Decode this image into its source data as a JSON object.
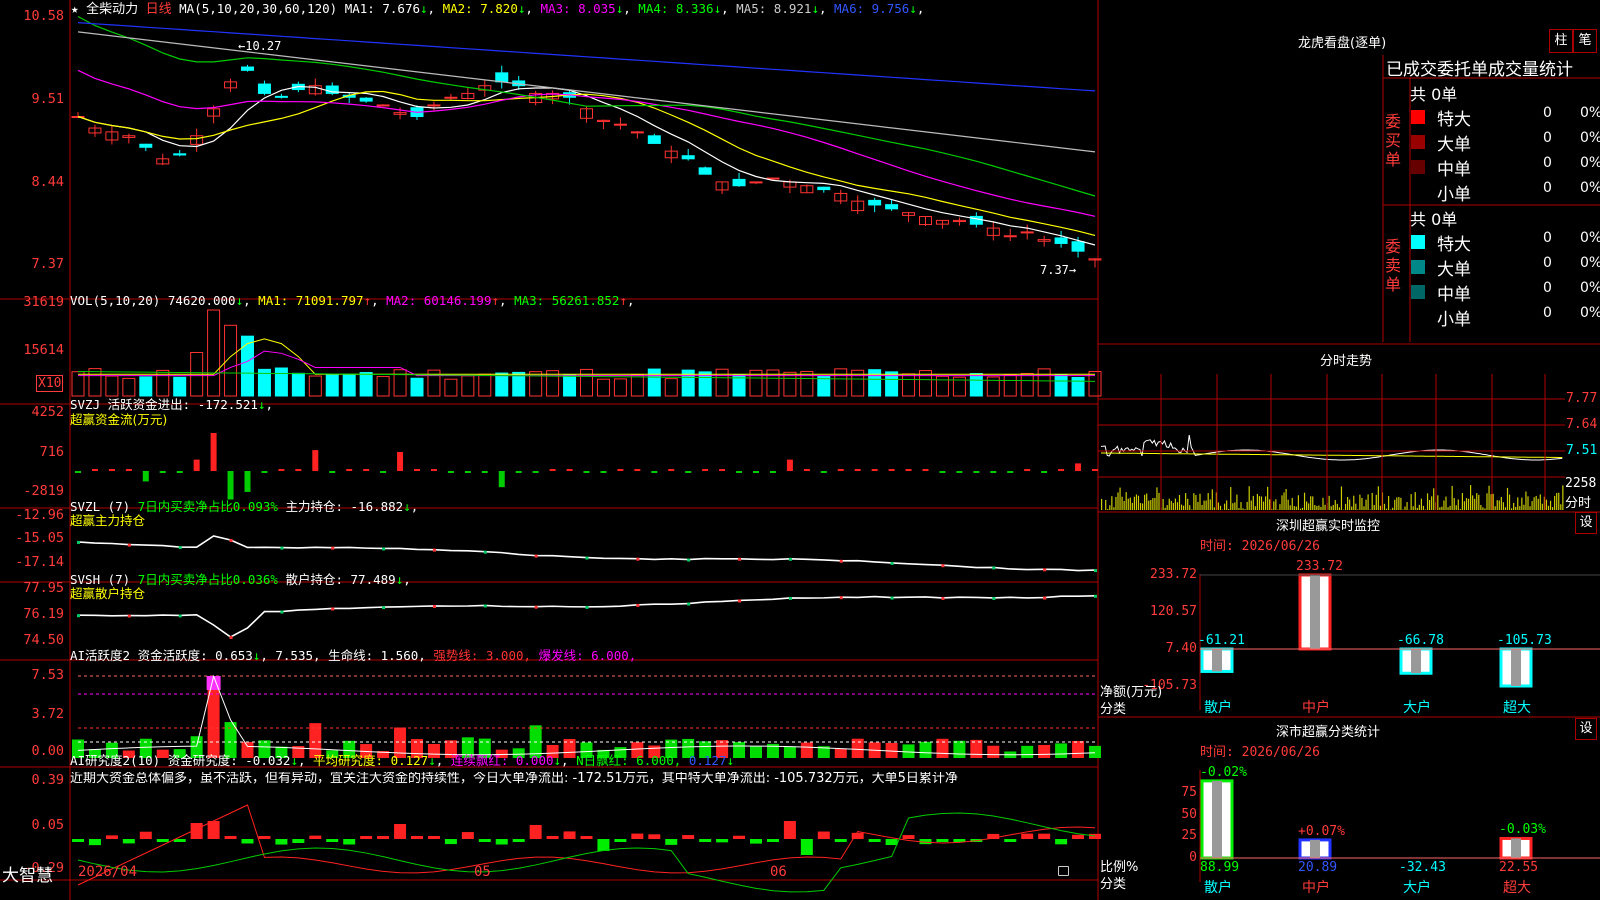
{
  "main_chart": {
    "star": "★",
    "stock_name": "全柴动力",
    "period": "日线",
    "ma_params": "MA(5,10,20,30,60,120)",
    "ma_values": [
      {
        "label": "MA1:",
        "value": "7.676",
        "arrow": "↓",
        "color": "#ffffff"
      },
      {
        "label": "MA2:",
        "value": "7.820",
        "arrow": "↓",
        "color": "#ffff00"
      },
      {
        "label": "MA3:",
        "value": "8.035",
        "arrow": "↓",
        "color": "#ff00ff"
      },
      {
        "label": "MA4:",
        "value": "8.336",
        "arrow": "↓",
        "color": "#00ff00"
      },
      {
        "label": "MA5:",
        "value": "8.921",
        "arrow": "↓",
        "color": "#cccccc"
      },
      {
        "label": "MA6:",
        "value": "9.756",
        "arrow": "↓",
        "color": "#3355ff"
      }
    ],
    "y_ticks": [
      "10.58",
      "9.51",
      "8.44",
      "7.37"
    ],
    "high_label": "10.27",
    "low_label": "7.37"
  },
  "vol": {
    "title": "VOL(5,10,20)",
    "value": "74620.000",
    "arrow": "↓",
    "mas": [
      {
        "label": "MA1:",
        "value": "71091.797",
        "arrow": "↑",
        "color": "#ffff00"
      },
      {
        "label": "MA2:",
        "value": "60146.199",
        "arrow": "↑",
        "color": "#ff00ff"
      },
      {
        "label": "MA3:",
        "value": "56261.852",
        "arrow": "↑",
        "color": "#00ff00"
      }
    ],
    "y_ticks": [
      "31619",
      "15614"
    ],
    "unit": "X10"
  },
  "svzj": {
    "title": "SVZJ",
    "line": "活跃资金进出: -172.521",
    "arrow": "↓",
    "sub": "超赢资金流(万元)",
    "y_ticks": [
      "4252",
      "716",
      "-2819"
    ]
  },
  "svzl": {
    "title": "SVZL  (7)",
    "ratio": "7日内买卖净占比0.093%",
    "hold": "主力持仓: -16.882",
    "arrow": "↓",
    "tail": ",",
    "sub": "超赢主力持仓",
    "y_ticks": [
      "-12.96",
      "-15.05",
      "-17.14"
    ]
  },
  "svsh": {
    "title": "SVSH  (7)",
    "ratio": "7日内买卖净占比0.036%",
    "hold": "散户持仓: 77.489",
    "arrow": "↓",
    "tail": ",",
    "sub": "超赢散户持仓",
    "y_ticks": [
      "77.95",
      "76.19",
      "74.50"
    ]
  },
  "ai_active": {
    "title": "AI活跃度2",
    "a": "资金活跃度: 0.653",
    "a_arrow": "↓",
    "b": ", 7.535,",
    "c": "生命线: 1.560,",
    "d": "强势线: 3.000,",
    "e": "爆发线: 6.000,",
    "y_ticks": [
      "7.53",
      "3.72",
      "0.00"
    ]
  },
  "ai_research": {
    "title": "AI研究度2(10)",
    "a": "资金研究度: -0.032",
    "a_arrow": "↓",
    "b": "平均研究度: 0.127",
    "b_arrow": "↓",
    "c": "连续飘红: 0.000",
    "c_arrow": "↓",
    "d": "N日飘红: 6.000,",
    "e": "0.127",
    "e_arrow": "↓",
    "comment": "近期大资金总体偏多，虽不活跃，但有异动，宜关注大资金的持续性，今日大单净流出: -172.51万元，其中特大单净流出: -105.732万元，大单5日累计净",
    "y_ticks": [
      "0.39",
      "0.05",
      "-0.29"
    ]
  },
  "date_axis": {
    "brand": "大智慧",
    "dates": [
      "2026/04",
      "05",
      "06"
    ]
  },
  "dragon_tiger": {
    "title": "龙虎看盘(逐单)",
    "btn_bar": "柱",
    "btn_pen": "笔",
    "header": "已成交委托单成交量统计",
    "buy_label": "委买单",
    "sell_label": "委卖单",
    "buy_total": "共 0单",
    "sell_total": "共 0单",
    "buy_rows": [
      {
        "name": "特大",
        "color": "#ff0000",
        "count": "0",
        "pct": "0%"
      },
      {
        "name": "大单",
        "color": "#990000",
        "count": "0",
        "pct": "0%"
      },
      {
        "name": "中单",
        "color": "#660000",
        "count": "0",
        "pct": "0%"
      },
      {
        "name": "小单",
        "color": "",
        "count": "0",
        "pct": "0%"
      }
    ],
    "sell_rows": [
      {
        "name": "特大",
        "color": "#00ffff",
        "count": "0",
        "pct": "0%"
      },
      {
        "name": "大单",
        "color": "#008888",
        "count": "0",
        "pct": "0%"
      },
      {
        "name": "中单",
        "color": "#006666",
        "count": "0",
        "pct": "0%"
      },
      {
        "name": "小单",
        "color": "",
        "count": "0",
        "pct": "0%"
      }
    ]
  },
  "intraday": {
    "title": "分时走势",
    "price_ticks": [
      "7.77",
      "7.64",
      "7.51"
    ],
    "vol_tick": "2258",
    "vol_label": "分时"
  },
  "sz_monitor": {
    "title": "深圳超赢实时监控",
    "btn": "设",
    "time": "时间: 2026/06/26",
    "y_ticks": [
      "233.72",
      "120.57",
      "7.40",
      "-105.73"
    ],
    "y_label": "净额(万元)",
    "x_label": "分类",
    "categories": [
      "散户",
      "中户",
      "大户",
      "超大"
    ],
    "values": [
      -61.21,
      233.72,
      -66.78,
      -105.73
    ],
    "value_labels": [
      "-61.21",
      "233.72",
      "-66.78",
      "-105.73"
    ]
  },
  "sz_class": {
    "title": "深市超赢分类统计",
    "btn": "设",
    "time": "时间: 2026/06/26",
    "y_ticks": [
      "75",
      "50",
      "25",
      "0"
    ],
    "y_label": "比例%",
    "x_label": "分类",
    "categories": [
      "散户",
      "中户",
      "大户",
      "超大"
    ],
    "pct_values": [
      88.99,
      20.89,
      -32.43,
      22.55
    ],
    "change_labels": [
      "-0.02%",
      "+0.07%",
      "",
      "-0.03%"
    ],
    "value_labels": [
      "88.99",
      "20.89",
      "-32.43",
      "22.55"
    ]
  },
  "colors": {
    "up": "#ff3333",
    "down": "#00ffff",
    "grid_red": "#b00000",
    "axis_text": "#ff3b3b"
  }
}
